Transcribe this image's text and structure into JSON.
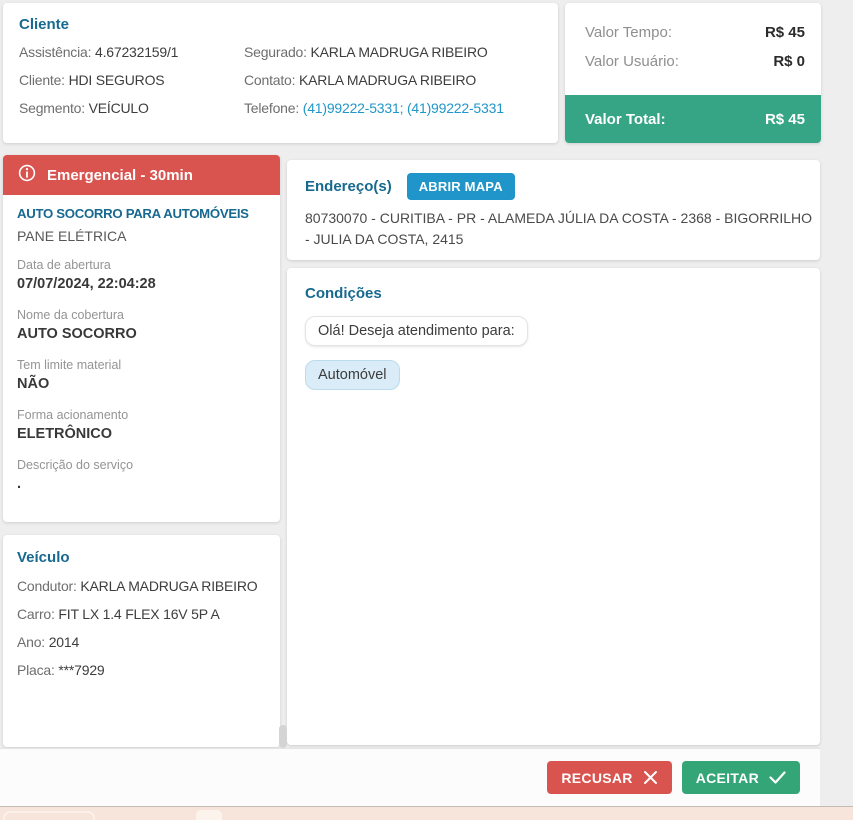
{
  "colors": {
    "accent_blue": "#176990",
    "link_blue": "#2196c9",
    "danger_red": "#d9534f",
    "success_green": "#36a585",
    "map_button_blue": "#1f95ca"
  },
  "client_card": {
    "title": "Cliente",
    "fields_left": [
      {
        "label": "Assistência:",
        "value": "4.67232159/1"
      },
      {
        "label": "Cliente:",
        "value": "HDI SEGUROS"
      },
      {
        "label": "Segmento:",
        "value": "VEÍCULO"
      }
    ],
    "fields_right": [
      {
        "label": "Segurado:",
        "value": "KARLA MADRUGA RIBEIRO"
      },
      {
        "label": "Contato:",
        "value": "KARLA MADRUGA RIBEIRO"
      },
      {
        "label": "Telefone:",
        "value": "(41)99222-5331; (41)99222-5331"
      }
    ]
  },
  "pricing_card": {
    "rows": [
      {
        "label": "Valor Tempo:",
        "value": "R$ 45"
      },
      {
        "label": "Valor Usuário:",
        "value": "R$ 0"
      }
    ],
    "total": {
      "label": "Valor Total:",
      "value": "R$ 45"
    }
  },
  "service_card": {
    "header": "Emergencial - 30min",
    "title": "AUTO SOCORRO PARA AUTOMÓVEIS",
    "subtitle": "PANE ELÉTRICA",
    "fields": [
      {
        "label": "Data de abertura",
        "value": "07/07/2024, 22:04:28"
      },
      {
        "label": "Nome da cobertura",
        "value": "AUTO SOCORRO"
      },
      {
        "label": "Tem limite material",
        "value": "NÃO"
      },
      {
        "label": "Forma acionamento",
        "value": "ELETRÔNICO"
      },
      {
        "label": "Descrição do serviço",
        "value": "."
      }
    ]
  },
  "vehicle_card": {
    "title": "Veículo",
    "fields": [
      {
        "label": "Condutor:",
        "value": "KARLA MADRUGA RIBEIRO"
      },
      {
        "label": "Carro:",
        "value": "FIT LX 1.4 FLEX 16V 5P A"
      },
      {
        "label": "Ano:",
        "value": "2014"
      },
      {
        "label": "Placa:",
        "value": "***7929"
      }
    ]
  },
  "address_card": {
    "title": "Endereço(s)",
    "map_button_label": "ABRIR MAPA",
    "address": "80730070 - CURITIBA - PR - ALAMEDA JÚLIA DA COSTA - 2368 - BIGORRILHO - JULIA DA COSTA, 2415"
  },
  "conditions_card": {
    "title": "Condições",
    "messages": [
      {
        "text": "Olá! Deseja atendimento para:"
      },
      {
        "text": "Automóvel"
      }
    ]
  },
  "footer": {
    "reject_label": "RECUSAR",
    "accept_label": "ACEITAR"
  }
}
